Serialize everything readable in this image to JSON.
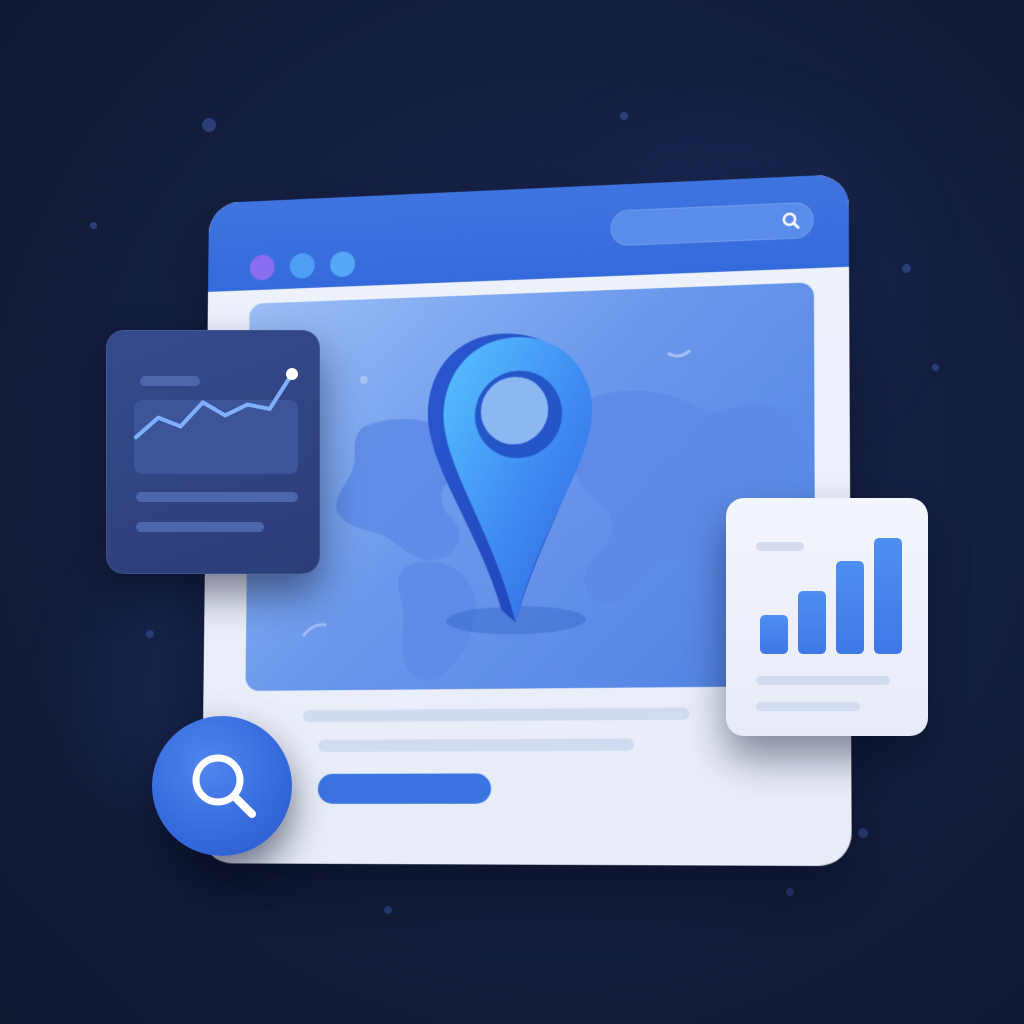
{
  "colors": {
    "background": "#131d3d",
    "accent": "#3b73e0",
    "titlebar": "#3a70de",
    "window_body": "#eaeff9",
    "dot_purple": "#8a6ef0",
    "dot_blue_1": "#4f9ef5",
    "dot_blue_2": "#56a8f7",
    "pin_light": "#4fb6ff",
    "pin_dark": "#2f5fdb",
    "line_card": "#31458a",
    "bar_card_columns": "#4685ee"
  },
  "icons": {
    "window_controls": [
      "window-control-dot-icon",
      "window-control-dot-icon",
      "window-control-dot-icon"
    ],
    "address_bar": "search-icon",
    "map_marker": "location-pin-icon",
    "floating_search": "search-icon",
    "line_chart": "line-chart-icon",
    "bar_chart": "bar-chart-icon"
  },
  "mini_line_chart": {
    "type": "line",
    "values": [
      30,
      48,
      40,
      62,
      50,
      60,
      56,
      88
    ]
  },
  "mini_bar_chart": {
    "type": "bar",
    "values": [
      34,
      54,
      80,
      100
    ]
  }
}
